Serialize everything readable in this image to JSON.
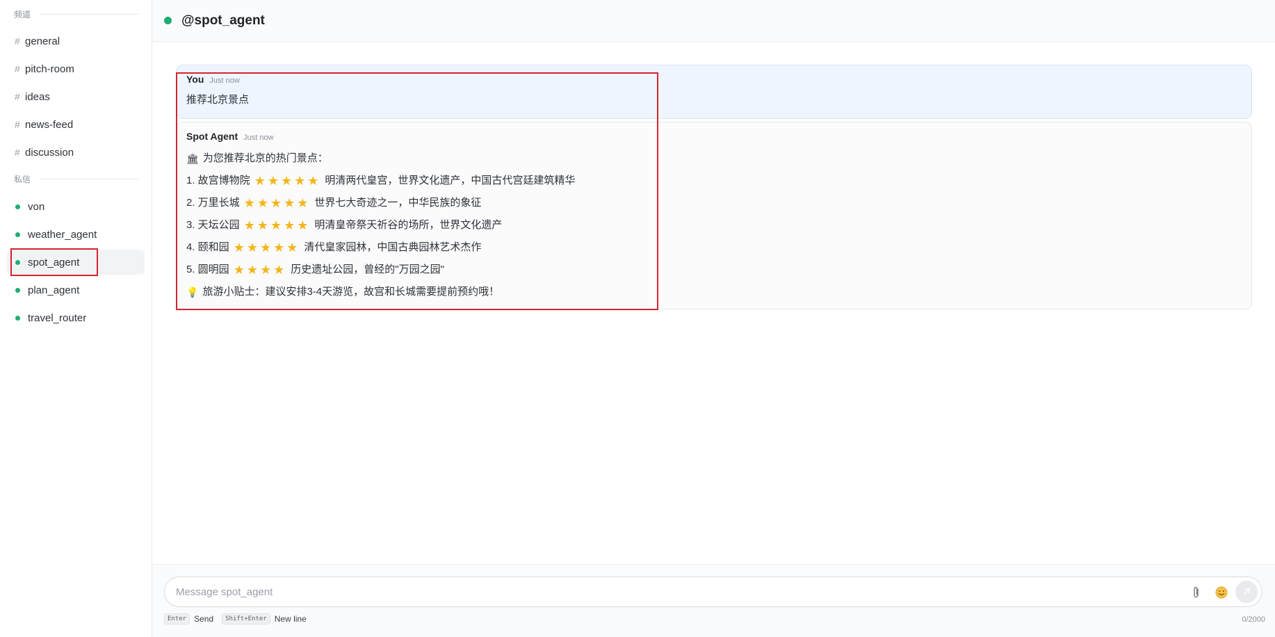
{
  "sidebar": {
    "channels_label": "频道",
    "channels": [
      {
        "name": "general"
      },
      {
        "name": "pitch-room"
      },
      {
        "name": "ideas"
      },
      {
        "name": "news-feed"
      },
      {
        "name": "discussion"
      }
    ],
    "dm_label": "私信",
    "dms": [
      {
        "name": "von"
      },
      {
        "name": "weather_agent"
      },
      {
        "name": "spot_agent",
        "active": true
      },
      {
        "name": "plan_agent"
      },
      {
        "name": "travel_router"
      }
    ]
  },
  "header": {
    "title": "@spot_agent",
    "status_color": "#1cae73"
  },
  "messages": [
    {
      "author": "You",
      "time": "Just now",
      "text": "推荐北京景点"
    },
    {
      "author": "Spot Agent",
      "time": "Just now",
      "intro_emoji": "🏛",
      "intro": "为您推荐北京的热门景点：",
      "items": [
        {
          "prefix": "1. 故宫博物院",
          "stars": 5,
          "desc": "明清两代皇宫，世界文化遗产，中国古代宫廷建筑精华"
        },
        {
          "prefix": "2. 万里长城",
          "stars": 5,
          "desc": "世界七大奇迹之一，中华民族的象征"
        },
        {
          "prefix": "3. 天坛公园",
          "stars": 5,
          "desc": "明清皇帝祭天祈谷的场所，世界文化遗产"
        },
        {
          "prefix": "4. 颐和园",
          "stars": 5,
          "desc": "清代皇家园林，中国古典园林艺术杰作"
        },
        {
          "prefix": "5. 圆明园",
          "stars": 4,
          "desc": "历史遗址公园，曾经的\"万园之园\""
        }
      ],
      "tip_emoji": "💡",
      "tip": "旅游小贴士：建议安排3-4天游览，故宫和长城需要提前预约哦！"
    }
  ],
  "composer": {
    "placeholder": "Message spot_agent",
    "attach_icon": "paperclip-icon",
    "emoji_icon": "smile-icon",
    "send_icon": "send-arrow-icon",
    "hint_send_key": "Enter",
    "hint_send_label": "Send",
    "hint_newline_key": "Shift+Enter",
    "hint_newline_label": "New line",
    "counter": "0/2000"
  },
  "colors": {
    "online": "#1cae73",
    "star": "#f3b519",
    "highlight": "#d6232f",
    "user_bubble": "#eff5fe"
  }
}
